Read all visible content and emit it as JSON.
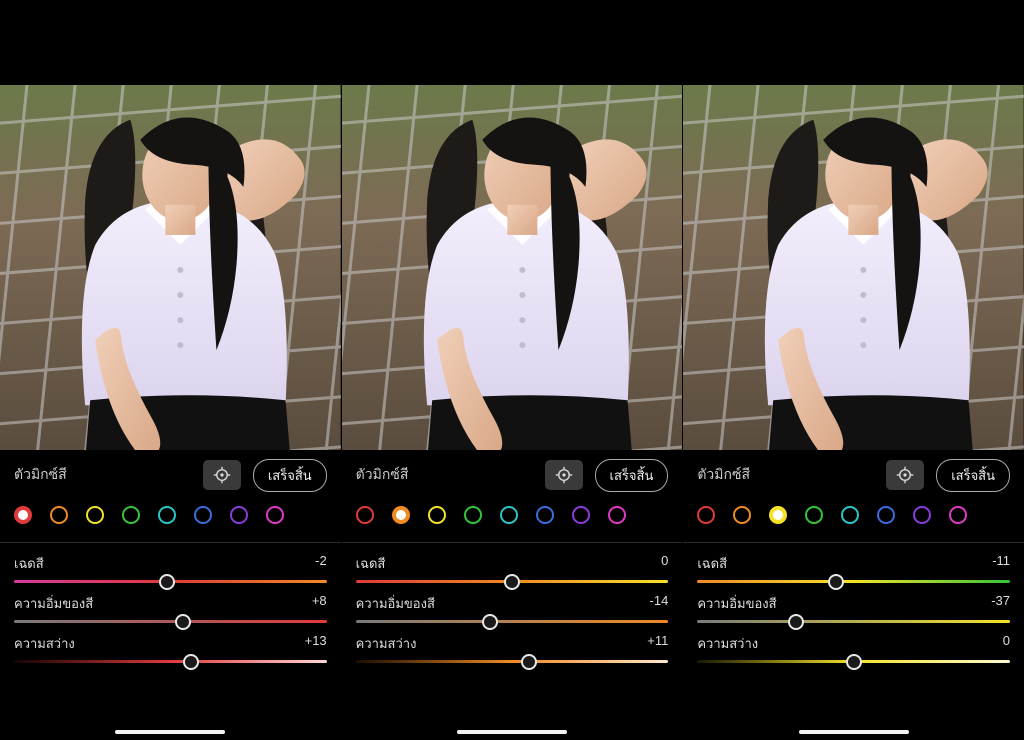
{
  "swatch_colors": [
    "#e03a3a",
    "#f08a24",
    "#f4e22a",
    "#35c43a",
    "#2ac6c6",
    "#3b6bdc",
    "#8a3bdc",
    "#e03ac2"
  ],
  "panels": [
    {
      "title": "ตัวมิกซ์สี",
      "done_label": "เสร็จสิ้น",
      "selected_swatch_index": 0,
      "sliders": [
        {
          "label": "เฉดสี",
          "value": -2,
          "gradient": [
            "#d63aa0",
            "#e03a3a",
            "#f08a24"
          ]
        },
        {
          "label": "ความอิ่มของสี",
          "value": 8,
          "gradient": [
            "#7a7a7a",
            "#e03a3a"
          ]
        },
        {
          "label": "ความสว่าง",
          "value": 13,
          "gradient": [
            "#140404",
            "#e03a3a",
            "#ffd7d7"
          ]
        }
      ]
    },
    {
      "title": "ตัวมิกซ์สี",
      "done_label": "เสร็จสิ้น",
      "selected_swatch_index": 1,
      "sliders": [
        {
          "label": "เฉดสี",
          "value": 0,
          "gradient": [
            "#e03a3a",
            "#f08a24",
            "#f4e22a"
          ]
        },
        {
          "label": "ความอิ่มของสี",
          "value": -14,
          "gradient": [
            "#7a7a7a",
            "#f08a24"
          ]
        },
        {
          "label": "ความสว่าง",
          "value": 11,
          "gradient": [
            "#1a0e02",
            "#f08a24",
            "#ffe7c8"
          ]
        }
      ]
    },
    {
      "title": "ตัวมิกซ์สี",
      "done_label": "เสร็จสิ้น",
      "selected_swatch_index": 2,
      "sliders": [
        {
          "label": "เฉดสี",
          "value": -11,
          "gradient": [
            "#f08a24",
            "#f4e22a",
            "#35c43a"
          ]
        },
        {
          "label": "ความอิ่มของสี",
          "value": -37,
          "gradient": [
            "#7a7a7a",
            "#f4e22a"
          ]
        },
        {
          "label": "ความสว่าง",
          "value": 0,
          "gradient": [
            "#1a1702",
            "#f4e22a",
            "#fffad0"
          ]
        }
      ]
    }
  ]
}
